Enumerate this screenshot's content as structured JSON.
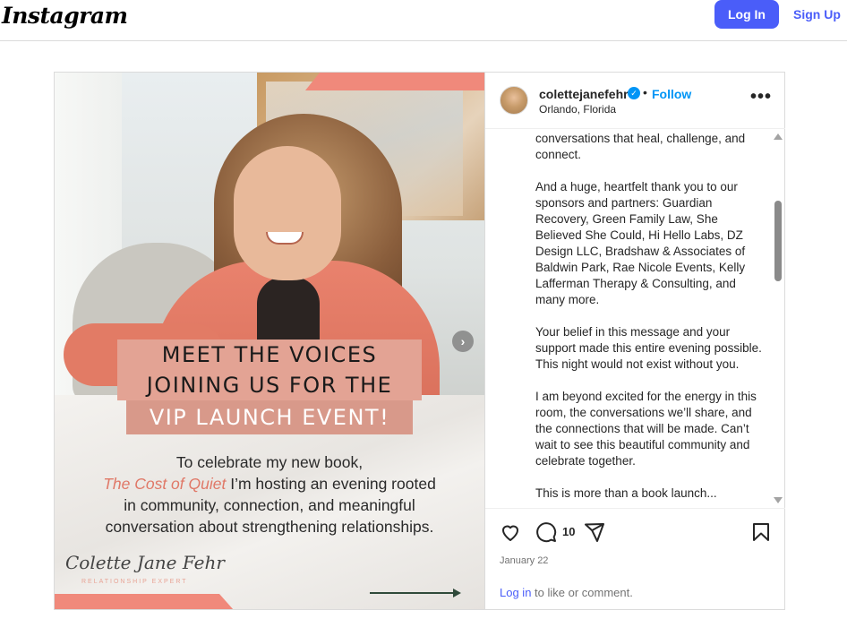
{
  "header": {
    "logo": "Instagram",
    "login_label": "Log In",
    "signup_label": "Sign Up"
  },
  "media": {
    "headline_line1": "MEET THE VOICES",
    "headline_line2": "JOINING US FOR THE",
    "headline_line3": "VIP LAUNCH EVENT!",
    "body_line1": "To celebrate my new book,",
    "book_title": "The Cost of Quiet",
    "body_line2_rest": " I’m hosting an evening rooted",
    "body_line3": "in community, connection, and meaningful",
    "body_line4": "conversation about strengthening relationships.",
    "signature": "Colette Jane Fehr",
    "signature_subtitle": "RELATIONSHIP EXPERT",
    "next_icon": "chevron-right-icon"
  },
  "post_header": {
    "username": "colettejanefehr",
    "separator": "•",
    "follow_label": "Follow",
    "location": "Orlando, Florida",
    "more_icon": "more-options-icon"
  },
  "caption": {
    "p1": "conversations that heal, challenge, and connect.",
    "p2": "And a huge, heartfelt thank you to our sponsors and partners: Guardian Recovery, Green Family Law, She Believed She Could, Hi Hello Labs, DZ Design LLC, Bradshaw & Associates of Baldwin Park, Rae Nicole Events, Kelly Lafferman Therapy & Consulting, and many more.",
    "p3": "Your belief in this message and your support made this entire evening possible. This night would not exist without you.",
    "p4": "I am beyond excited for the energy in this room, the conversations we’ll share, and the connections that will be made. Can’t wait to see this beautiful community and celebrate together.",
    "p5": "This is more than a book launch..."
  },
  "actions": {
    "comment_count": "10",
    "date": "January 22",
    "login_link": "Log in",
    "login_rest": " to like or comment."
  },
  "colors": {
    "brand_blue": "#4a5df9",
    "follow_blue": "#0095f6",
    "accent_pink": "#f0897b"
  }
}
